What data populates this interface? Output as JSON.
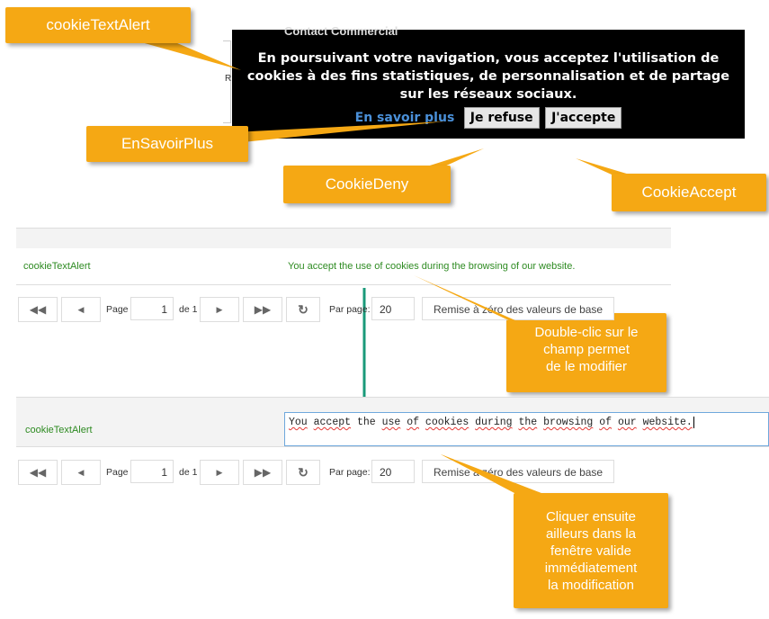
{
  "banner": {
    "header": "Contact Commercial",
    "text": "En poursuivant votre navigation, vous acceptez l'utilisation de cookies à des fins statistiques, de personnalisation et de partage sur les réseaux sociaux.",
    "link": "En savoir plus",
    "deny": "Je refuse",
    "accept": "J'accepte",
    "edge_letter": "R"
  },
  "callouts": {
    "cookieTextAlert": "cookieTextAlert",
    "enSavoirPlus": "EnSavoirPlus",
    "cookieDeny": "CookieDeny",
    "cookieAccept": "CookieAccept",
    "doubleClick": [
      "Double-clic sur le",
      "champ permet",
      "de le modifier"
    ],
    "clickElsewhere": [
      "Cliquer ensuite",
      "ailleurs dans la",
      "fenêtre valide",
      "immédiatement",
      "la modification"
    ]
  },
  "grid1": {
    "key": "cookieTextAlert",
    "value": "You accept the use of cookies during the browsing of our website."
  },
  "grid2": {
    "key": "cookieTextAlert",
    "value_words": [
      "You",
      "accept",
      "the",
      "use",
      "of",
      "cookies",
      "during",
      "the",
      "browsing",
      "of",
      "our",
      "website."
    ]
  },
  "pager1": {
    "page_label": "Page",
    "page_value": "1",
    "of_label": "de 1",
    "per_page_label": "Par page:",
    "per_page_value": "20",
    "reset_label": "Remise à zéro des valeurs de base"
  },
  "pager2": {
    "page_label": "Page",
    "page_value": "1",
    "of_label": "de 1",
    "per_page_label": "Par page:",
    "per_page_value": "20",
    "reset_label": "Remise à zéro des valeurs de base"
  },
  "colors": {
    "callout": "#f5a814",
    "banner_bg": "#000000",
    "link": "#4a90d9",
    "grid_text": "#2e8b22",
    "arrow": "#1a9a7a"
  }
}
